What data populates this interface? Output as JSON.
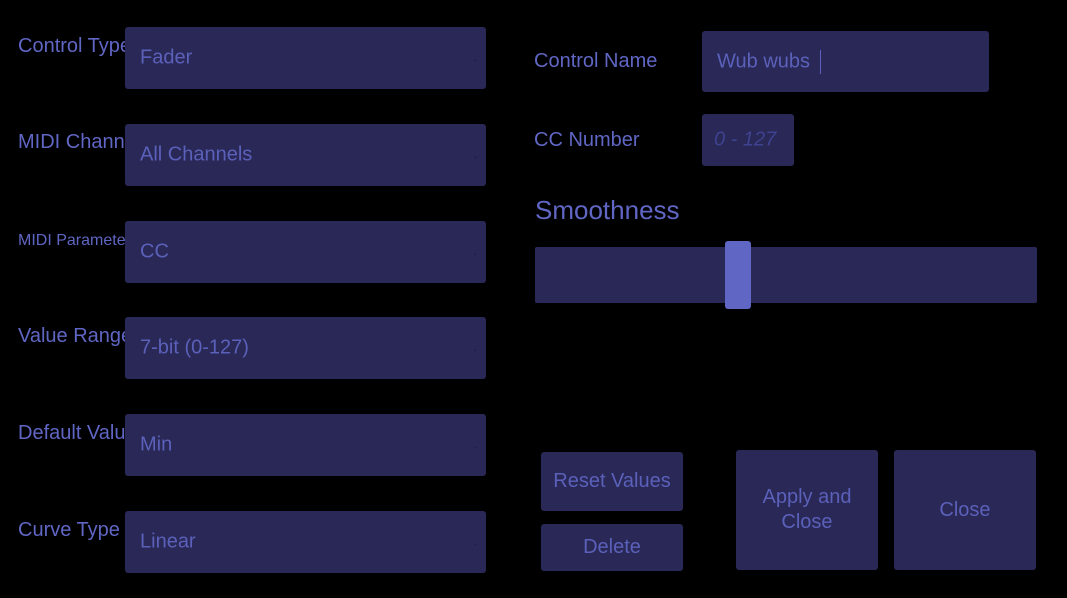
{
  "left_fields": [
    {
      "label": "Control Type",
      "value": "Fader"
    },
    {
      "label": "MIDI Channel",
      "value": "All Channels"
    },
    {
      "label": "MIDI Parameter",
      "value": "CC"
    },
    {
      "label": "Value Range",
      "value": "7-bit (0-127)"
    },
    {
      "label": "Default Value",
      "value": "Min"
    },
    {
      "label": "Curve Type",
      "value": "Linear"
    }
  ],
  "control_name": {
    "label": "Control Name",
    "value": "Wub wubs"
  },
  "cc_number": {
    "label": "CC Number",
    "placeholder": "0 - 127",
    "value": ""
  },
  "smoothness": {
    "label": "Smoothness",
    "value_fraction": 0.4
  },
  "buttons": {
    "reset": "Reset Values",
    "delete": "Delete",
    "apply_close": "Apply and Close",
    "close": "Close"
  },
  "colors": {
    "background": "#000000",
    "panel": "#292856",
    "text": "#6066c4",
    "slider_handle": "#6066c4"
  }
}
